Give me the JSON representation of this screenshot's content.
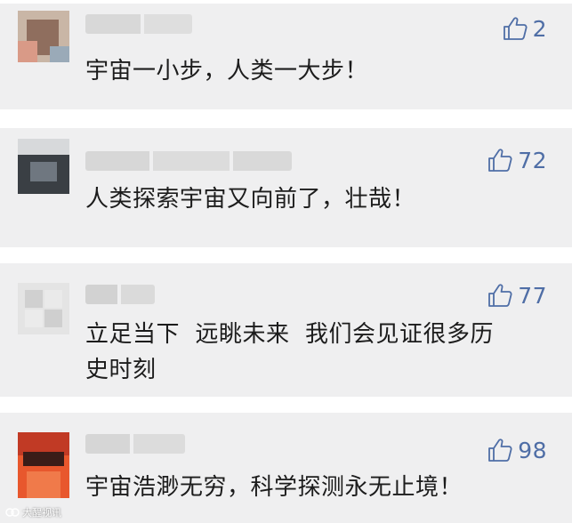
{
  "comments": [
    {
      "likes": "2",
      "text": "宇宙一小步，人类一大步！"
    },
    {
      "likes": "72",
      "text": "人类探索宇宙又向前了，壮哉！"
    },
    {
      "likes": "77",
      "text": "立足当下  远眺未来  我们会见证很多历\n史时刻"
    },
    {
      "likes": "98",
      "text": "宇宙浩渺无穷，科学探测永无止境！"
    }
  ],
  "watermark": {
    "text": "大醒视讯"
  },
  "colors": {
    "card_background": "#efeff0",
    "like_accent": "#4f6ea6",
    "comment_text": "#1c1c1c"
  },
  "icons": {
    "like": "thumbs-up-outline-icon",
    "watermark": "logo-icon"
  }
}
